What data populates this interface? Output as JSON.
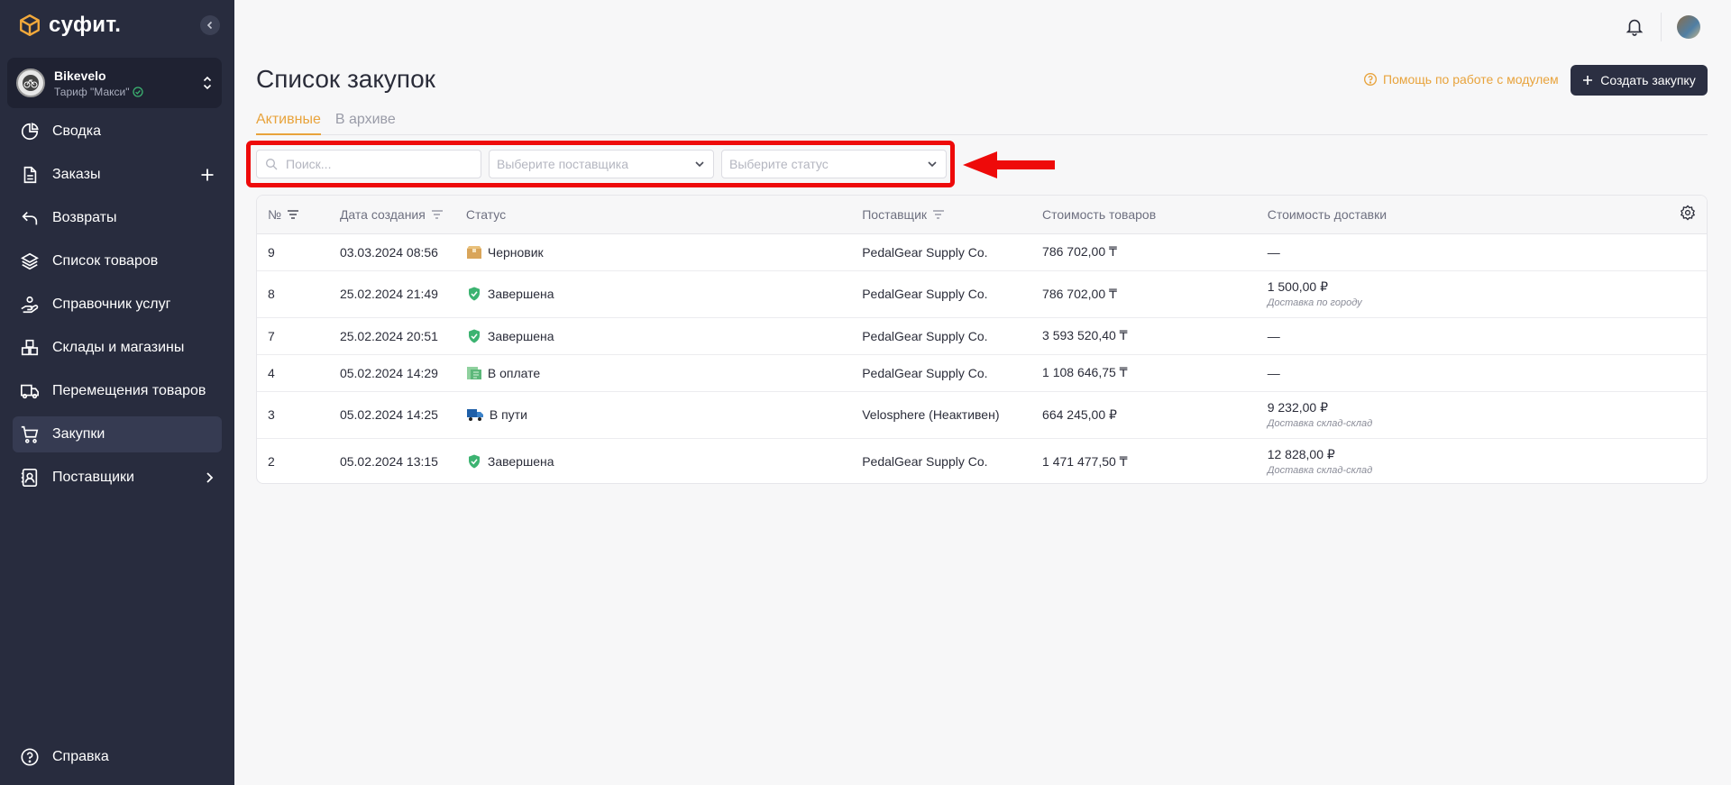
{
  "app": {
    "logo_text": "суфит."
  },
  "account": {
    "name": "Bikevelo",
    "plan": "Тариф \"Макси\""
  },
  "sidebar": {
    "items": [
      {
        "label": "Сводка",
        "icon": "chart-pie-icon"
      },
      {
        "label": "Заказы",
        "icon": "document-icon"
      },
      {
        "label": "Возвраты",
        "icon": "return-arrow-icon"
      },
      {
        "label": "Список товаров",
        "icon": "layers-icon"
      },
      {
        "label": "Справочник услуг",
        "icon": "service-hand-icon"
      },
      {
        "label": "Склады и магазины",
        "icon": "boxes-icon"
      },
      {
        "label": "Перемещения товаров",
        "icon": "truck-icon"
      },
      {
        "label": "Закупки",
        "icon": "cart-icon",
        "active": true
      },
      {
        "label": "Поставщики",
        "icon": "contact-book-icon"
      }
    ],
    "help_label": "Справка"
  },
  "header": {
    "title": "Список закупок",
    "help_link": "Помощь по работе с модулем",
    "create_button": "Создать закупку"
  },
  "tabs": [
    {
      "label": "Активные",
      "active": true
    },
    {
      "label": "В архиве",
      "active": false
    }
  ],
  "filters": {
    "search_placeholder": "Поиск...",
    "supplier_placeholder": "Выберите поставщика",
    "status_placeholder": "Выберите статус"
  },
  "table": {
    "columns": [
      "№",
      "Дата создания",
      "Статус",
      "Поставщик",
      "Стоимость товаров",
      "Стоимость доставки"
    ],
    "rows": [
      {
        "num": "9",
        "date": "03.03.2024 08:56",
        "status": "Черновик",
        "status_icon": "box-icon",
        "supplier": "PedalGear Supply Co.",
        "goods_cost": "786 702,00 ₸",
        "delivery_cost": "—",
        "delivery_note": ""
      },
      {
        "num": "8",
        "date": "25.02.2024 21:49",
        "status": "Завершена",
        "status_icon": "shield-check-icon",
        "supplier": "PedalGear Supply Co.",
        "goods_cost": "786 702,00 ₸",
        "delivery_cost": "1 500,00 ₽",
        "delivery_note": "Доставка по городу"
      },
      {
        "num": "7",
        "date": "25.02.2024 20:51",
        "status": "Завершена",
        "status_icon": "shield-check-icon",
        "supplier": "PedalGear Supply Co.",
        "goods_cost": "3 593 520,40 ₸",
        "delivery_cost": "—",
        "delivery_note": ""
      },
      {
        "num": "4",
        "date": "05.02.2024 14:29",
        "status": "В оплате",
        "status_icon": "money-icon",
        "supplier": "PedalGear Supply Co.",
        "goods_cost": "1 108 646,75 ₸",
        "delivery_cost": "—",
        "delivery_note": ""
      },
      {
        "num": "3",
        "date": "05.02.2024 14:25",
        "status": "В пути",
        "status_icon": "delivery-truck-icon",
        "supplier": "Velosphere (Неактивен)",
        "goods_cost": "664 245,00 ₽",
        "delivery_cost": "9 232,00 ₽",
        "delivery_note": "Доставка склад-склад"
      },
      {
        "num": "2",
        "date": "05.02.2024 13:15",
        "status": "Завершена",
        "status_icon": "shield-check-icon",
        "supplier": "PedalGear Supply Co.",
        "goods_cost": "1 471 477,50 ₸",
        "delivery_cost": "12 828,00 ₽",
        "delivery_note": "Доставка склад-склад"
      }
    ]
  },
  "colors": {
    "sidebar_bg": "#282c3e",
    "accent": "#e8a33c",
    "highlight_red": "#ee0a0a",
    "success_green": "#3cb371"
  }
}
